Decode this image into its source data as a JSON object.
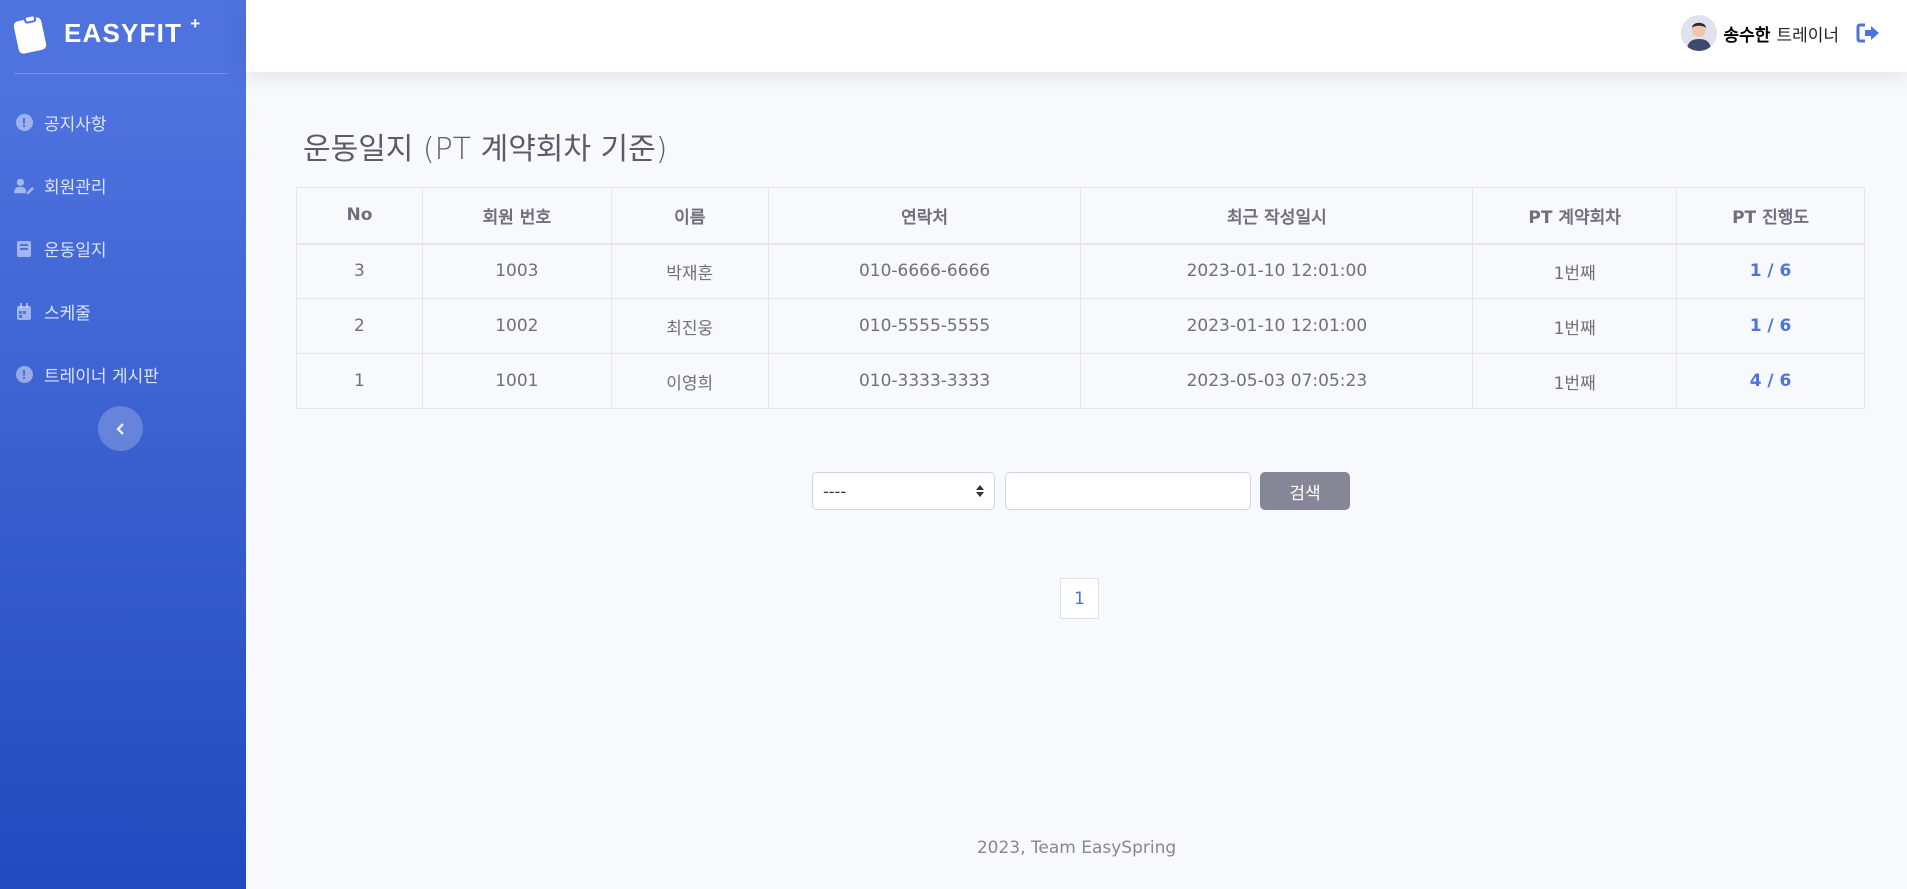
{
  "brand": {
    "name": "EASYFIT",
    "sup": "+"
  },
  "sidebar": {
    "items": [
      {
        "label": "공지사항",
        "icon": "exclamation-circle-icon"
      },
      {
        "label": "회원관리",
        "icon": "user-edit-icon"
      },
      {
        "label": "운동일지",
        "icon": "book-icon"
      },
      {
        "label": "스케줄",
        "icon": "calendar-icon"
      },
      {
        "label": "트레이너 게시판",
        "icon": "exclamation-circle-icon"
      }
    ],
    "toggle_icon": "chevron-left-icon"
  },
  "topbar": {
    "user_name": "송수한",
    "user_role": "트레이너",
    "logout_icon": "sign-out-icon"
  },
  "main": {
    "title": "운동일지 (PT 계약회차 기준)",
    "table": {
      "columns": [
        "No",
        "회원 번호",
        "이름",
        "연락처",
        "최근 작성일시",
        "PT 계약회차",
        "PT 진행도"
      ],
      "rows": [
        [
          "3",
          "1003",
          "박재훈",
          "010-6666-6666",
          "2023-01-10 12:01:00",
          "1번째",
          "1 / 6"
        ],
        [
          "2",
          "1002",
          "최진웅",
          "010-5555-5555",
          "2023-01-10 12:01:00",
          "1번째",
          "1 / 6"
        ],
        [
          "1",
          "1001",
          "이영희",
          "010-3333-3333",
          "2023-05-03 07:05:23",
          "1번째",
          "4 / 6"
        ]
      ]
    },
    "search": {
      "select_value": "----",
      "input_value": "",
      "button_label": "검색"
    },
    "pagination": {
      "current": "1"
    }
  },
  "footer": {
    "text": "2023, Team EasySpring"
  },
  "colors": {
    "primary": "#4e73df",
    "sidebar_bottom": "#224abe",
    "muted": "#858796"
  }
}
